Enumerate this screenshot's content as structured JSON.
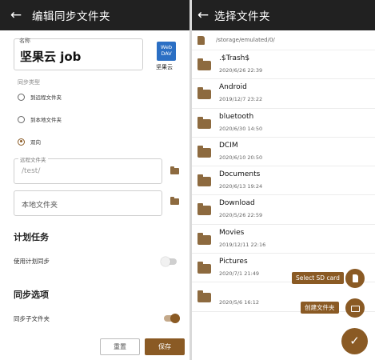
{
  "left": {
    "title": "编辑同步文件夹",
    "name_caption": "名称",
    "name_value": "坚果云 job",
    "provider_badge": "Web DAV",
    "provider_label": "坚果云",
    "sync_type_label": "同步类型",
    "options": [
      "到远程文件夹",
      "到本地文件夹",
      "双向"
    ],
    "selected_option": "双向",
    "remote_folder_caption": "远程文件夹",
    "remote_folder_value": "/test/",
    "local_folder_placeholder": "本地文件夹",
    "schedule_section": "计划任务",
    "use_schedule_label": "使用计划同步",
    "use_schedule_on": false,
    "sync_options_section": "同步选项",
    "sync_subfolders_label": "同步子文件夹",
    "sync_subfolders_on": true,
    "reset_button": "重置",
    "save_button": "保存"
  },
  "right": {
    "title": "选择文件夹",
    "path": "/storage/emulated/0/",
    "folders": [
      {
        "name": ".$Trash$",
        "date": "2020/6/26 22:39"
      },
      {
        "name": "Android",
        "date": "2019/12/7 23:22"
      },
      {
        "name": "bluetooth",
        "date": "2020/6/30 14:50"
      },
      {
        "name": "DCIM",
        "date": "2020/6/10 20:50"
      },
      {
        "name": "Documents",
        "date": "2020/6/13 19:24"
      },
      {
        "name": "Download",
        "date": "2020/5/26 22:59"
      },
      {
        "name": "Movies",
        "date": "2019/12/11 22:16"
      },
      {
        "name": "Pictures",
        "date": "2020/7/1 21:49"
      },
      {
        "name": "",
        "date": "2020/5/6 16:12"
      }
    ],
    "select_sd_card_label": "Select SD card",
    "create_folder_label": "创建文件夹",
    "confirm_icon": "check-icon"
  },
  "colors": {
    "accent": "#8a5a24",
    "appbar": "#212121",
    "webdav": "#2b6fc4"
  }
}
